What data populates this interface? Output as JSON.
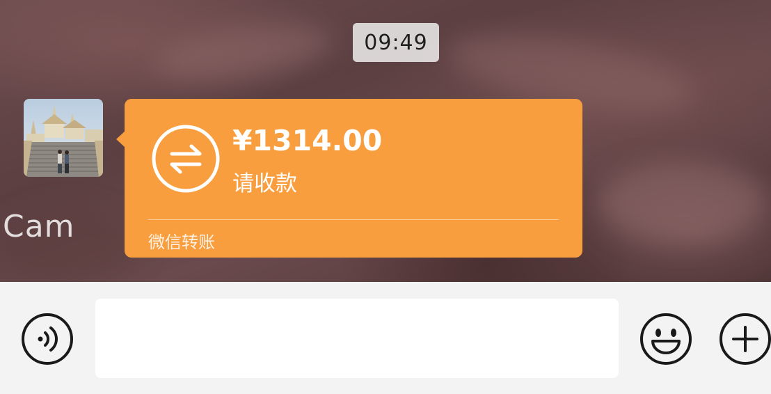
{
  "chat": {
    "timestamp": "09:49",
    "watermark": "Cam",
    "message": {
      "type": "transfer",
      "amount": "¥1314.00",
      "status": "请收款",
      "source_label": "微信转账",
      "bubble_color": "#f99e3e"
    },
    "avatar_icon": "avatar-photo"
  },
  "input_bar": {
    "voice_icon": "voice-icon",
    "text_value": "",
    "emoji_icon": "emoji-icon",
    "plus_icon": "plus-icon"
  }
}
